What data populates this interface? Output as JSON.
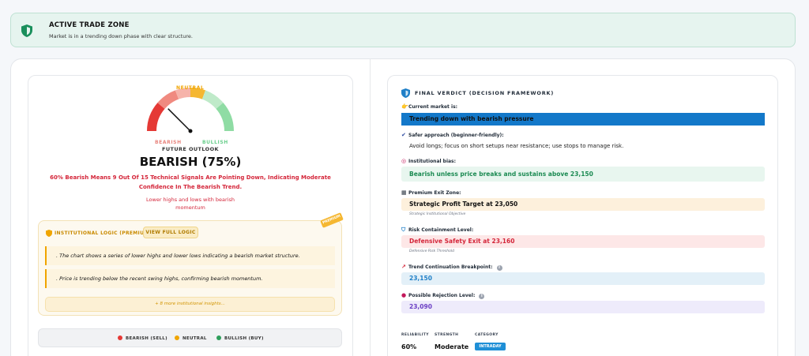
{
  "banner": {
    "title": "ACTIVE TRADE ZONE",
    "subtitle": "Market is in a trending down phase with clear structure."
  },
  "gauge": {
    "neutral_label": "NEUTRAL",
    "bearish_label": "BEARISH",
    "bullish_label": "BULLISH",
    "outlook_label": "FUTURE OUTLOOK",
    "value_label": "BEARISH (75%)",
    "bearish_fraction": 0.75,
    "description": "60% Bearish Means 9 Out Of 15 Technical Signals Are Pointing Down, Indicating Moderate Confidence In The Bearish Trend.",
    "note_line1": "Lower highs and lows with bearish",
    "note_line2": "momentum"
  },
  "institutional": {
    "badge": "PREMIUM",
    "title": "INSTITUTIONAL LOGIC (PREMIUM)",
    "view_button": "VIEW FULL LOGIC",
    "items": [
      ". The chart shows a series of lower highs and lower lows indicating a bearish market structure.",
      ". Price is trending below the recent swing highs, confirming bearish momentum."
    ],
    "more": "+ 8 more institutional insights..."
  },
  "legend": {
    "items": [
      {
        "label": "BEARISH (SELL)",
        "color": "#e53935"
      },
      {
        "label": "NEUTRAL",
        "color": "#f0a500"
      },
      {
        "label": "BULLISH (BUY)",
        "color": "#2e9e5b"
      }
    ]
  },
  "verdict": {
    "title": "FINAL VERDICT (DECISION FRAMEWORK)",
    "current_label": "Current market is:",
    "current_value": "Trending down with bearish pressure",
    "safer_label": "Safer approach (beginner-friendly):",
    "safer_text": "Avoid longs; focus on short setups near resistance; use stops to manage risk.",
    "bias_label": "Institutional bias:",
    "bias_value": "Bearish unless price breaks and sustains above 23,150",
    "exit_label": "Premium Exit Zone:",
    "exit_value": "Strategic Profit Target at 23,050",
    "exit_sub": "Strategic Institutional Objective",
    "risk_label": "Risk Containment Level:",
    "risk_value": "Defensive Safety Exit at 23,160",
    "risk_sub": "Defensive Risk Threshold",
    "trend_label": "Trend Continuation Breakpoint:",
    "trend_value": "23,150",
    "reject_label": "Possible Rejection Level:",
    "reject_value": "23,090"
  },
  "metrics": {
    "reliability_label": "RELIABILITY",
    "reliability_value": "60%",
    "strength_label": "STRENGTH",
    "strength_value": "Moderate",
    "category_label": "CATEGORY",
    "category_value": "INTRADAY"
  },
  "colors": {
    "bearish": "#e53935",
    "neutral": "#f5b731",
    "bullish": "#2e9e5b",
    "accent_blue": "#1f8fd6"
  }
}
